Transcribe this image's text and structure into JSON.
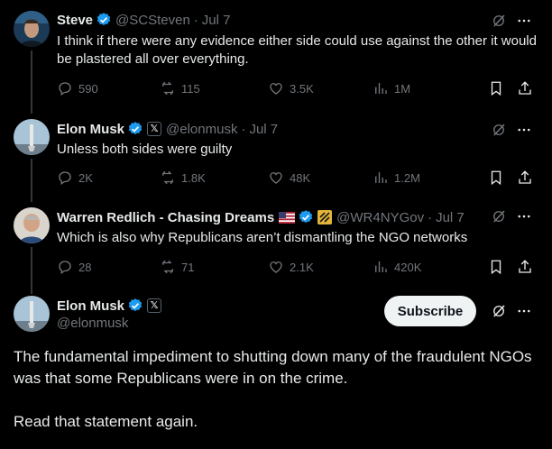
{
  "tweets": [
    {
      "name": "Steve",
      "handle": "@SCSteven",
      "dot": "·",
      "time": "Jul 7",
      "text": "I think if there were any evidence either side could use against the other it would be plastered all over everything.",
      "replies": "590",
      "reposts": "115",
      "likes": "3.5K",
      "views": "1M"
    },
    {
      "name": "Elon Musk",
      "handle": "@elonmusk",
      "dot": "·",
      "time": "Jul 7",
      "text": "Unless both sides were guilty",
      "replies": "2K",
      "reposts": "1.8K",
      "likes": "48K",
      "views": "1.2M"
    },
    {
      "name": "Warren Redlich - Chasing Dreams",
      "handle": "@WR4NYGov",
      "dot": "·",
      "time": "Jul 7",
      "text": "Which is also why Republicans aren’t  dismantling the NGO networks",
      "replies": "28",
      "reposts": "71",
      "likes": "2.1K",
      "views": "420K"
    }
  ],
  "main_tweet": {
    "name": "Elon Musk",
    "handle": "@elonmusk",
    "subscribe_label": "Subscribe",
    "paragraph1": "The fundamental impediment to shutting down many of the fraudulent NGOs was that some Republicans were in on the crime.",
    "paragraph2": "Read that statement again."
  },
  "colors": {
    "background": "#000000",
    "text_primary": "#e7e9ea",
    "text_secondary": "#71767b",
    "verified_blue": "#1d9bf0",
    "subscribe_bg": "#eff3f4"
  },
  "icons": [
    "reply-icon",
    "repost-icon",
    "like-icon",
    "views-icon",
    "bookmark-icon",
    "share-icon",
    "grok-icon",
    "more-icon",
    "verified-icon",
    "x-affiliate-icon"
  ]
}
